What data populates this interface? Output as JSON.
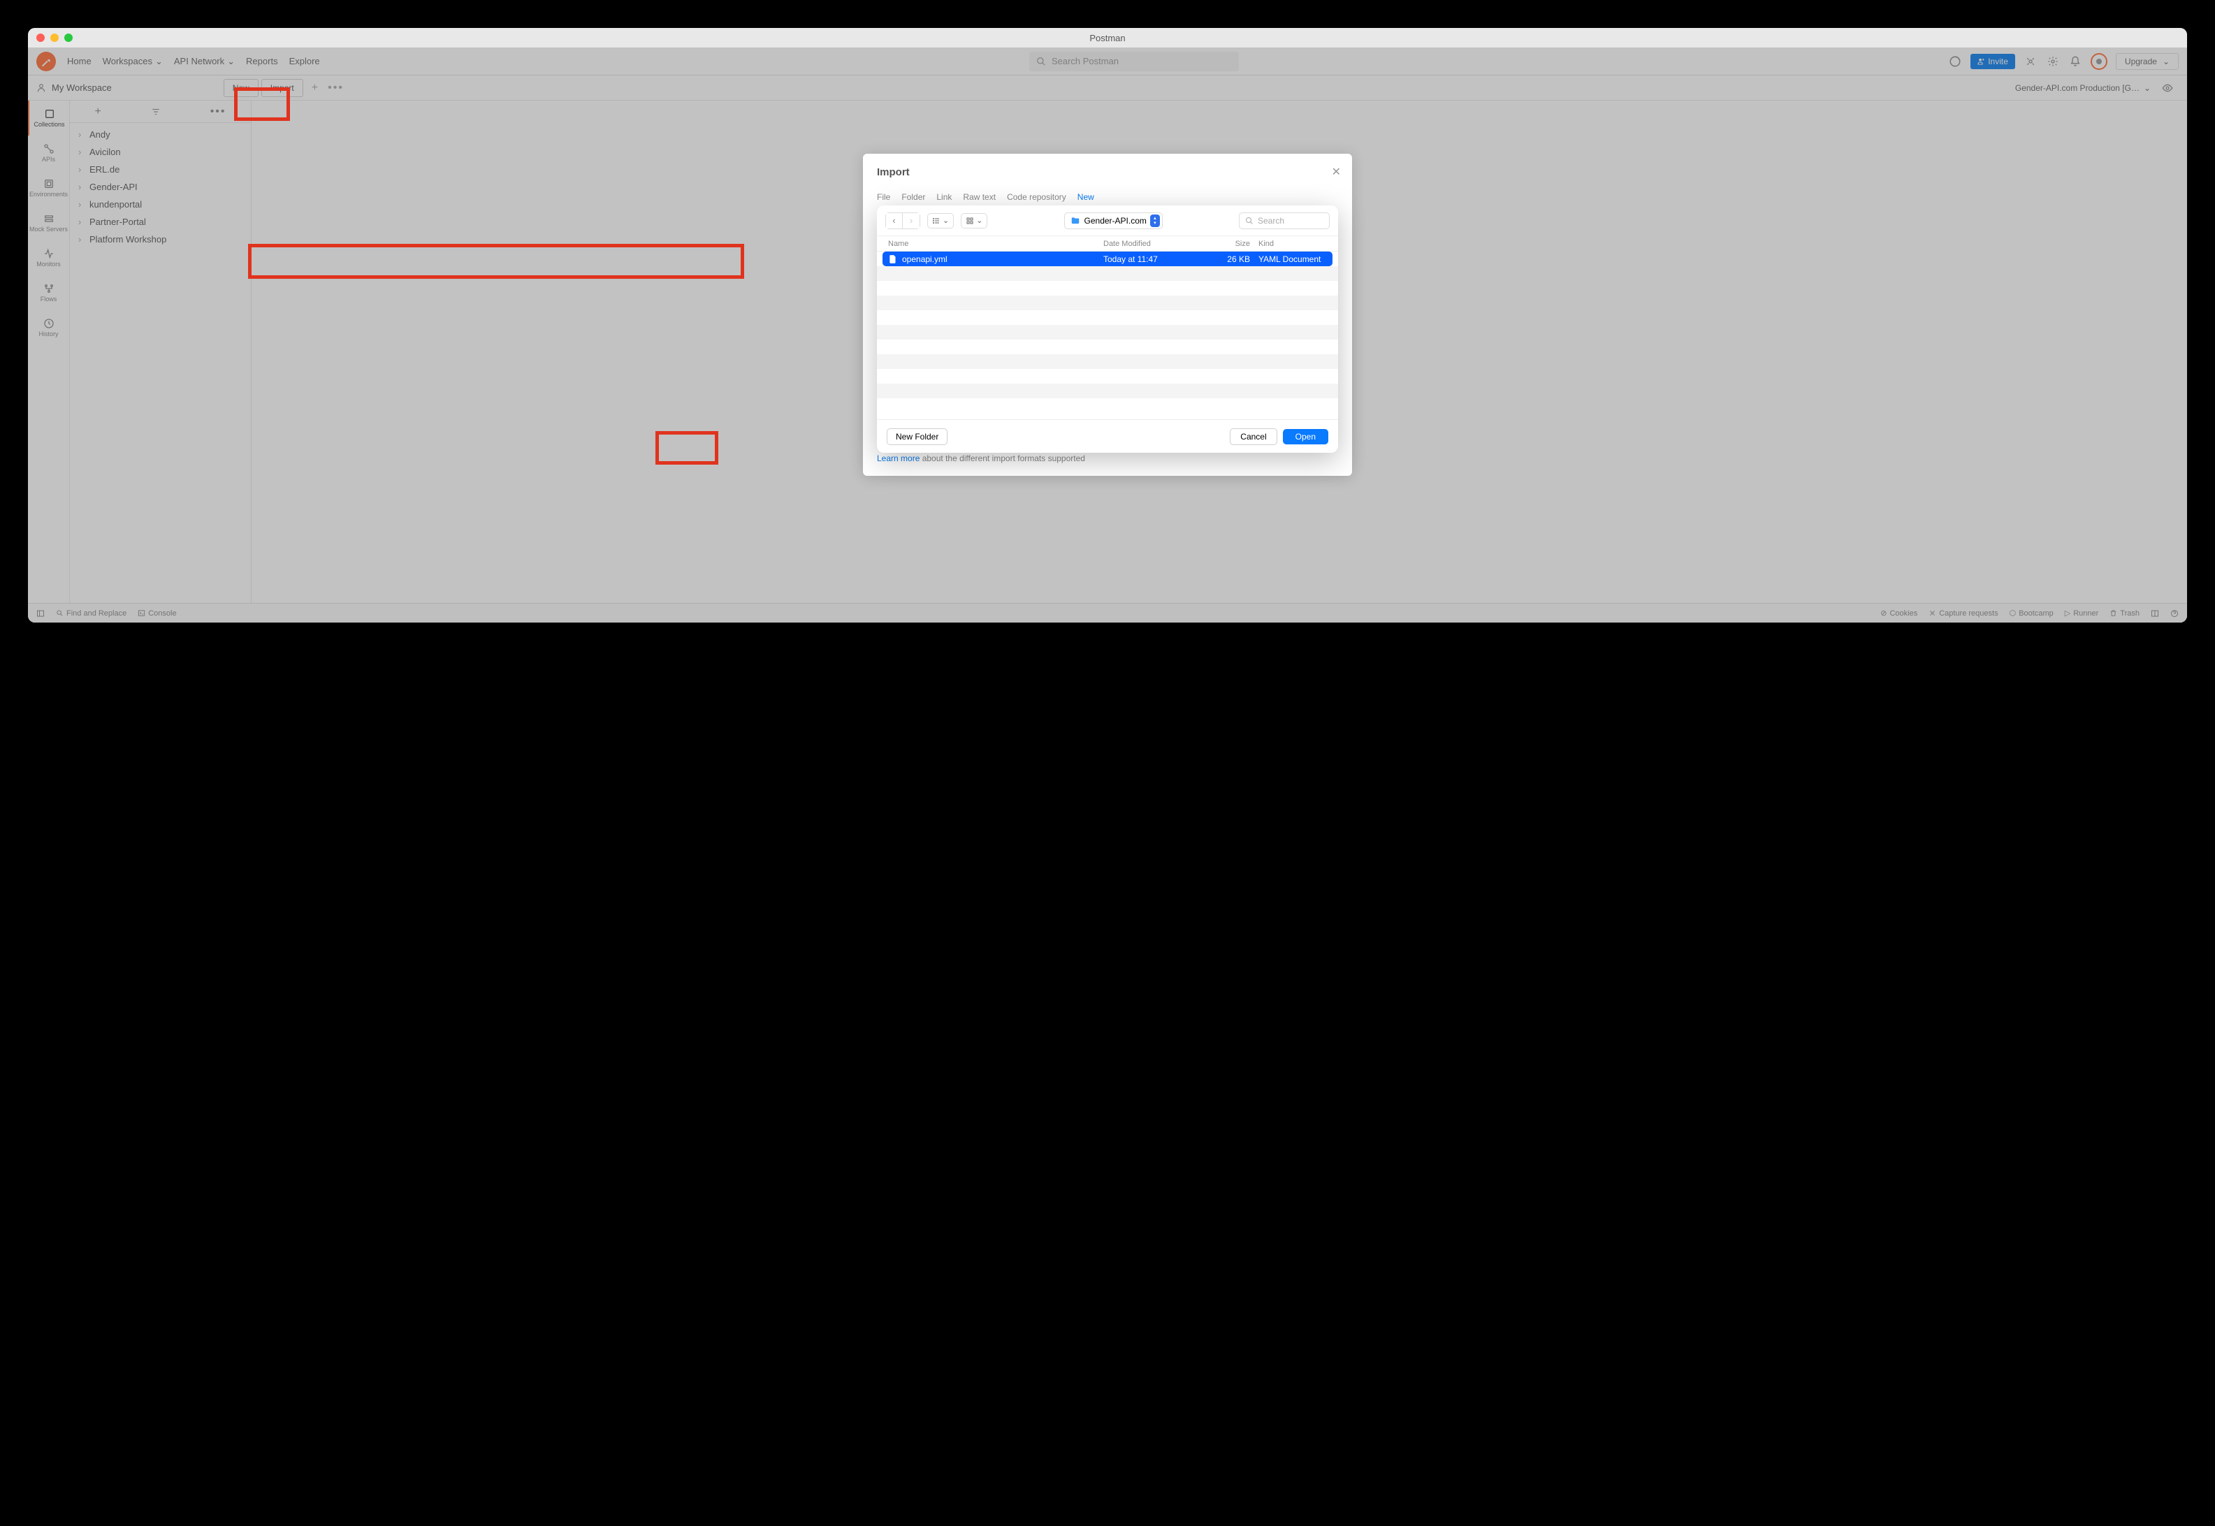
{
  "window": {
    "title": "Postman"
  },
  "topbar": {
    "home": "Home",
    "workspaces": "Workspaces",
    "api_network": "API Network",
    "reports": "Reports",
    "explore": "Explore",
    "search_placeholder": "Search Postman",
    "invite": "Invite",
    "upgrade": "Upgrade"
  },
  "workspace": {
    "name": "My Workspace",
    "new_btn": "New",
    "import_btn": "Import",
    "environment": "Gender-API.com Production [G…"
  },
  "sidebar": {
    "items": [
      {
        "label": "Collections"
      },
      {
        "label": "APIs"
      },
      {
        "label": "Environments"
      },
      {
        "label": "Mock Servers"
      },
      {
        "label": "Monitors"
      },
      {
        "label": "Flows"
      },
      {
        "label": "History"
      }
    ]
  },
  "collections": {
    "items": [
      {
        "name": "Andy"
      },
      {
        "name": "Avicilon"
      },
      {
        "name": "ERL.de"
      },
      {
        "name": "Gender-API"
      },
      {
        "name": "kundenportal"
      },
      {
        "name": "Partner-Portal"
      },
      {
        "name": "Platform Workshop"
      }
    ]
  },
  "import_modal": {
    "title": "Import",
    "tabs": {
      "file": "File",
      "folder": "Folder",
      "link": "Link",
      "raw": "Raw text",
      "code": "Code repository",
      "new": "New"
    },
    "learn_more": "Learn more",
    "learn_more_tail": " about the different import formats supported"
  },
  "filepicker": {
    "path": "Gender-API.com",
    "search_placeholder": "Search",
    "headers": {
      "name": "Name",
      "date": "Date Modified",
      "size": "Size",
      "kind": "Kind"
    },
    "file": {
      "name": "openapi.yml",
      "date": "Today at 11:47",
      "size": "26 KB",
      "kind": "YAML Document"
    },
    "new_folder": "New Folder",
    "cancel": "Cancel",
    "open": "Open"
  },
  "bottombar": {
    "find": "Find and Replace",
    "console": "Console",
    "cookies": "Cookies",
    "capture": "Capture requests",
    "bootcamp": "Bootcamp",
    "runner": "Runner",
    "trash": "Trash"
  }
}
